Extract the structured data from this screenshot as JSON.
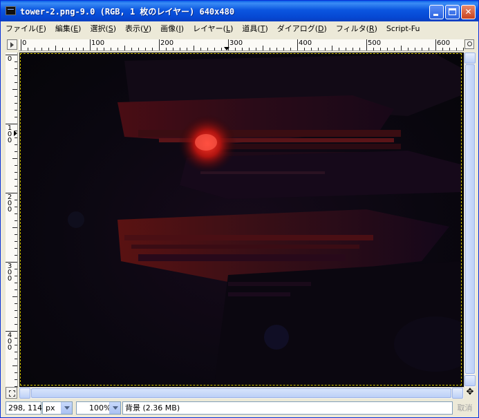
{
  "window": {
    "title": "tower-2.png-9.0 (RGB, 1 枚のレイヤー) 640x480"
  },
  "menu": [
    {
      "label": "ファイル(",
      "hot": "F",
      "end": ")"
    },
    {
      "label": "編集(",
      "hot": "E",
      "end": ")"
    },
    {
      "label": "選択(",
      "hot": "S",
      "end": ")"
    },
    {
      "label": "表示(",
      "hot": "V",
      "end": ")"
    },
    {
      "label": "画像(",
      "hot": "I",
      "end": ")"
    },
    {
      "label": "レイヤー(",
      "hot": "L",
      "end": ")"
    },
    {
      "label": "道具(",
      "hot": "T",
      "end": ")"
    },
    {
      "label": "ダイアログ(",
      "hot": "D",
      "end": ")"
    },
    {
      "label": "フィルタ(",
      "hot": "R",
      "end": ")"
    },
    {
      "label": "Script-Fu",
      "hot": "",
      "end": ""
    }
  ],
  "rulers": {
    "horizontal": [
      "0",
      "100",
      "200",
      "300",
      "400",
      "500",
      "600"
    ],
    "vertical": [
      "0",
      "100",
      "200",
      "300",
      "400"
    ]
  },
  "statusbar": {
    "coords": "298, 114",
    "unit": "px",
    "zoom": "100%",
    "layer_info": "背景 (2.36 MB)",
    "cancel": "取消"
  },
  "colors": {
    "title_bar": "#0b56e0",
    "selection_outline": "#e0d000",
    "canvas_bg": "#060509",
    "highlight_red": "#d01a10"
  },
  "icons": {
    "ruler_corner": "menu-arrow-icon",
    "zoom_corner": "zoom-icon",
    "quick_mask": "quick-mask-icon",
    "navigate": "navigate-icon"
  }
}
